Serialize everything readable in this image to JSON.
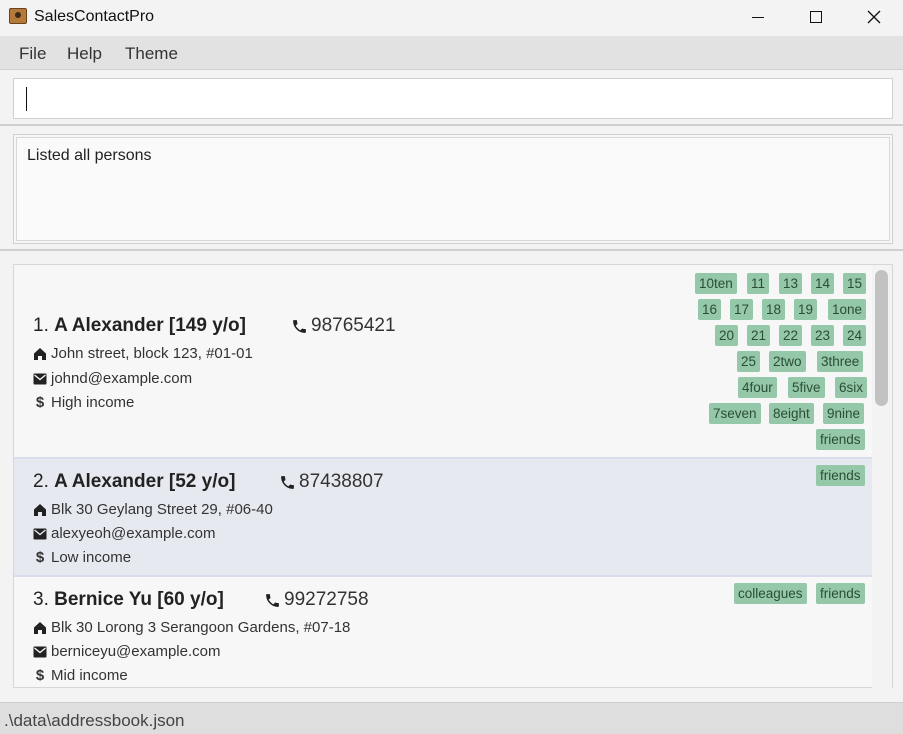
{
  "window": {
    "title": "SalesContactPro"
  },
  "menu": {
    "items": [
      "File",
      "Help",
      "Theme"
    ]
  },
  "command": {
    "value": "",
    "placeholder": ""
  },
  "result": {
    "text": "Listed all persons"
  },
  "persons": [
    {
      "index": "1.",
      "name": "A Alexander [149 y/o]",
      "phone": "98765421",
      "address": "John street, block 123, #01-01",
      "email": "johnd@example.com",
      "income": "High income",
      "tags": [
        "10ten",
        "11",
        "13",
        "14",
        "15",
        "16",
        "17",
        "18",
        "19",
        "1one",
        "20",
        "21",
        "22",
        "23",
        "24",
        "25",
        "2two",
        "3three",
        "4four",
        "5five",
        "6six",
        "7seven",
        "8eight",
        "9nine",
        "friends"
      ]
    },
    {
      "index": "2.",
      "name": "A Alexander [52 y/o]",
      "phone": "87438807",
      "address": "Blk 30 Geylang Street 29, #06-40",
      "email": "alexyeoh@example.com",
      "income": "Low income",
      "tags": [
        "friends"
      ]
    },
    {
      "index": "3.",
      "name": "Bernice Yu [60 y/o]",
      "phone": "99272758",
      "address": "Blk 30 Lorong 3 Serangoon Gardens, #07-18",
      "email": "berniceyu@example.com",
      "income": "Mid income",
      "tags": [
        "colleagues",
        "friends"
      ]
    }
  ],
  "status": {
    "path": ".\\data\\addressbook.json"
  },
  "icons": {
    "phone": "phone-icon",
    "address": "home-icon",
    "email": "mail-icon",
    "income": "dollar-icon"
  }
}
